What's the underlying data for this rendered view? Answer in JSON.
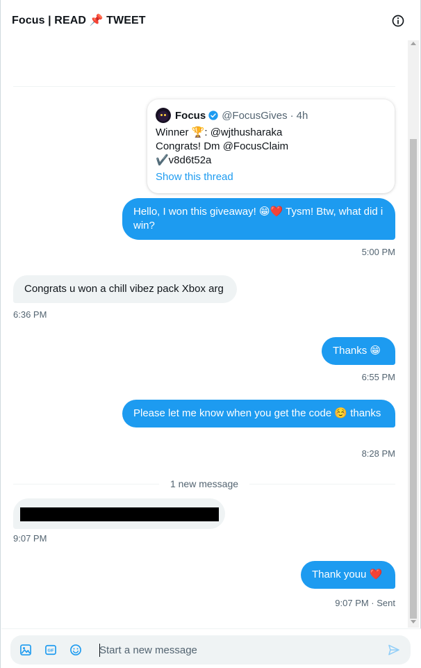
{
  "header": {
    "title": "Focus | READ 📌 TWEET"
  },
  "quote": {
    "name": "Focus",
    "handle": "@FocusGives",
    "time": "4h",
    "line1": "Winner 🏆: @wjthusharaka",
    "line2": "Congrats! Dm @FocusClaim",
    "line3": "✔️v8d6t52a",
    "show_thread": "Show this thread"
  },
  "messages": [
    {
      "id": "m1",
      "direction": "out",
      "text": "Hello, I won this giveaway! 😁❤️ Tysm! Btw, what did i win?",
      "time": "5:00 PM"
    },
    {
      "id": "m2",
      "direction": "in",
      "text": "Congrats u won a chill vibez pack Xbox arg",
      "time": "6:36 PM"
    },
    {
      "id": "m3",
      "direction": "out",
      "text": "Thanks 😁",
      "time": "6:55 PM"
    },
    {
      "id": "m4",
      "direction": "out",
      "text": "Please let me know when you get the code ☺️ thanks",
      "time": "8:28 PM"
    },
    {
      "id": "m5",
      "direction": "in",
      "text": "",
      "time": "9:07 PM",
      "redacted": true
    },
    {
      "id": "m6",
      "direction": "out",
      "text": "Thank youu ❤️",
      "time": "9:07 PM · Sent"
    }
  ],
  "divider": {
    "new_message": "1 new message"
  },
  "composer": {
    "placeholder": "Start a new message"
  },
  "colors": {
    "accent": "#1d9bf0",
    "incoming_bubble": "#eff3f4",
    "muted_text": "#536471"
  }
}
